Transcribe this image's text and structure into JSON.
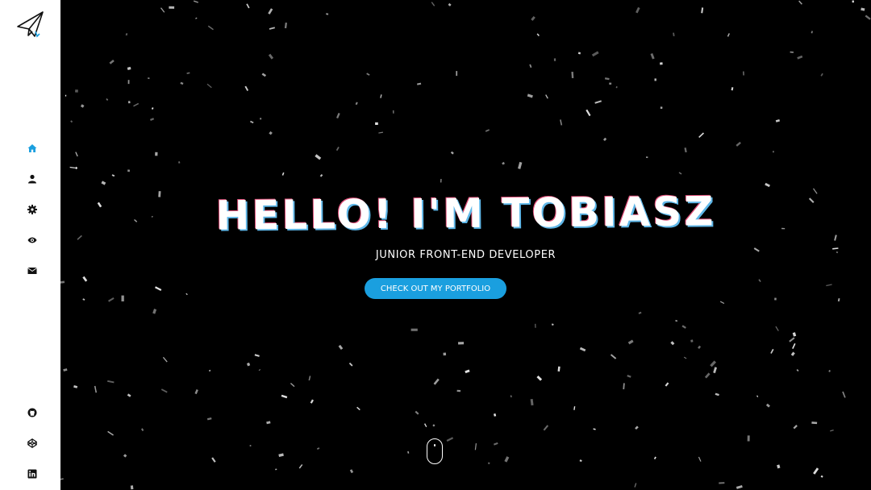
{
  "sidebar": {
    "logo_icon": "paper-plane-icon",
    "nav": [
      {
        "icon": "home-icon",
        "active": true
      },
      {
        "icon": "user-icon",
        "active": false
      },
      {
        "icon": "gear-icon",
        "active": false
      },
      {
        "icon": "eye-icon",
        "active": false
      },
      {
        "icon": "envelope-icon",
        "active": false
      }
    ],
    "social": [
      {
        "icon": "github-icon"
      },
      {
        "icon": "codepen-icon"
      },
      {
        "icon": "linkedin-icon"
      }
    ]
  },
  "hero": {
    "title": "HELLO! I'M TOBIASZ",
    "subtitle": "JUNIOR FRONT-END DEVELOPER",
    "cta_label": "CHECK OUT MY PORTFOLIO"
  },
  "colors": {
    "accent": "#1a9fdf",
    "nav_icon": "#111111",
    "sidebar_bg": "#ffffff",
    "main_bg": "#000000"
  }
}
